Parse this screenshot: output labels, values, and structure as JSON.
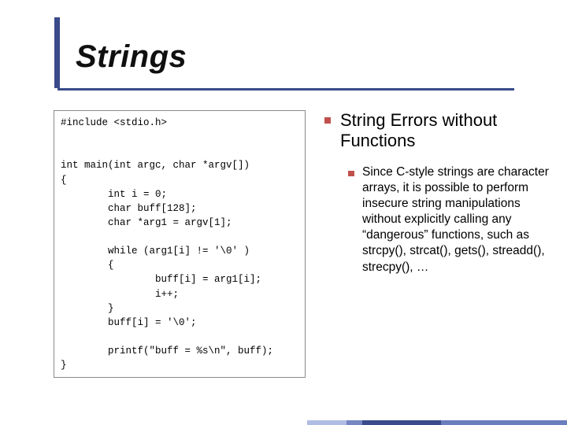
{
  "title": "Strings",
  "code": "#include <stdio.h>\n\n\nint main(int argc, char *argv[])\n{\n        int i = 0;\n        char buff[128];\n        char *arg1 = argv[1];\n\n        while (arg1[i] != '\\0' )\n        {\n                buff[i] = arg1[i];\n                i++;\n        }\n        buff[i] = '\\0';\n\n        printf(\"buff = %s\\n\", buff);\n}",
  "right": {
    "heading": "String Errors without Functions",
    "body": "Since C-style strings are character arrays, it is possible to perform insecure string manipulations without explicitly calling any “dangerous” functions, such as strcpy(), strcat(), gets(), streadd(), strecpy(), …"
  }
}
